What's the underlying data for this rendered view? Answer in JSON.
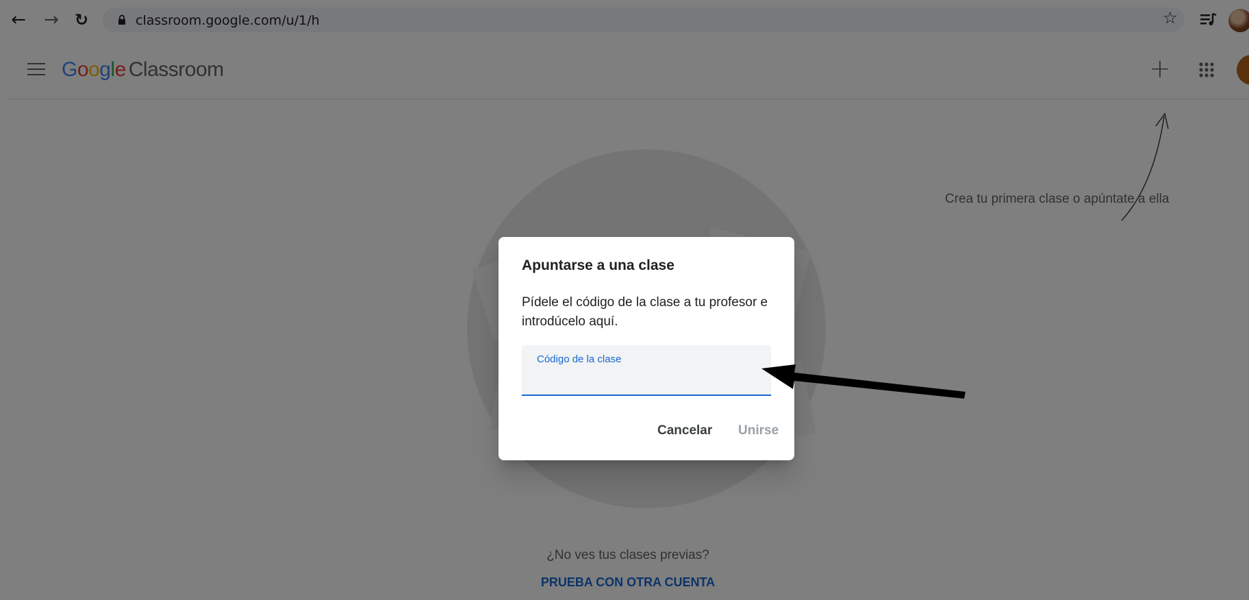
{
  "browser": {
    "url": "classroom.google.com/u/1/h",
    "icons": [
      "back-arrow-icon",
      "forward-arrow-icon",
      "reload-icon",
      "lock-icon",
      "star-icon",
      "media-queue-icon",
      "profile-avatar"
    ]
  },
  "header": {
    "brand_google": "Google",
    "brand_product": "Classroom",
    "google_colors": [
      "#4285f4",
      "#ea4335",
      "#fbbc05",
      "#4285f4",
      "#34a853",
      "#ea4335"
    ],
    "icons": [
      "menu-icon",
      "plus-icon",
      "apps-grid-icon",
      "user-avatar"
    ]
  },
  "main": {
    "hint_text": "Crea tu primera clase o apúntate a ella",
    "footer_question": "¿No ves tus clases previas?",
    "footer_link": "PRUEBA CON OTRA CUENTA"
  },
  "dialog": {
    "title": "Apuntarse a una clase",
    "description": "Pídele el código de la clase a tu profesor e introdúcelo aquí.",
    "field_label": "Código de la clase",
    "field_value": "",
    "cancel_label": "Cancelar",
    "join_label": "Unirse"
  },
  "colors": {
    "accent": "#1967d2",
    "scrim": "rgba(0,0,0,0.5)",
    "disabled_text": "#9aa0a6"
  }
}
